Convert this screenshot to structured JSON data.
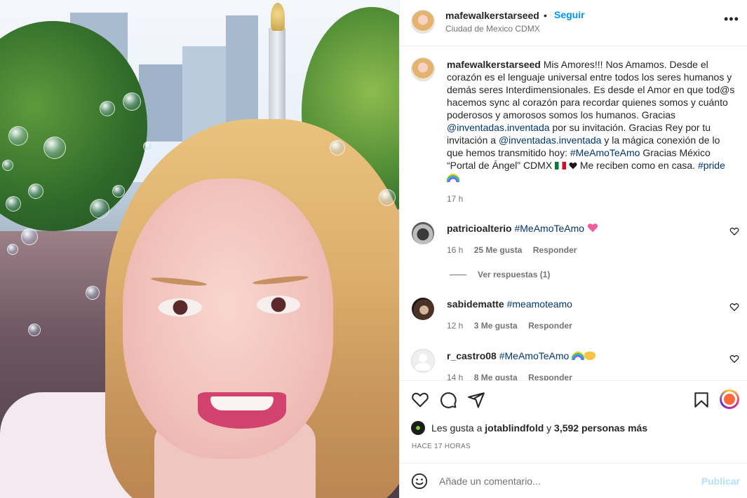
{
  "post": {
    "username": "mafewalkerstarseed",
    "separator": "•",
    "follow_label": "Seguir",
    "location": "Ciudad de Mexico CDMX",
    "more_label": "•••"
  },
  "caption": {
    "username": "mafewalkerstarseed",
    "text_1": "Mis Amores!!! Nos Amamos. Desde el corazón es el lenguaje universal entre todos los seres humanos y demás seres Interdimensionales. Es desde el Amor en que tod@s hacemos sync al corazón para recordar quienes somos y cuánto poderosos y amorosos somos los humanos. Gracias ",
    "mention_1": "@inventadas.inventada",
    "text_2": " por su invitación. Gracias Rey por tu invitación a ",
    "mention_2": "@inventadas.inventada",
    "text_3": " y la mágica conexión de lo que hemos transmitido hoy: ",
    "hashtag_1": "#MeAmoTeAmo",
    "text_4": " Gracias México “Portal de Ángel” CDMX ",
    "text_5": " Me reciben como en casa. ",
    "hashtag_2": "#pride",
    "time": "17 h"
  },
  "comments": [
    {
      "username": "patricioalterio",
      "hashtag": "#MeAmoTeAmo",
      "time": "16 h",
      "likes": "25 Me gusta",
      "reply_label": "Responder",
      "view_replies": "Ver respuestas (1)"
    },
    {
      "username": "sabidematte",
      "hashtag": "#meamoteamo",
      "time": "12 h",
      "likes": "3 Me gusta",
      "reply_label": "Responder"
    },
    {
      "username": "r_castro08",
      "hashtag": "#MeAmoTeAmo",
      "time": "14 h",
      "likes": "8 Me gusta",
      "reply_label": "Responder"
    }
  ],
  "likes_summary": {
    "prefix": "Les gusta a ",
    "user": "jotablindfold",
    "middle": " y ",
    "count": "3,592 personas más"
  },
  "posted_ago": "HACE 17 HORAS",
  "add_comment": {
    "placeholder": "Añade un comentario...",
    "publish_label": "Publicar"
  },
  "icons": {
    "like": "heart-icon",
    "comment": "comment-icon",
    "share": "share-icon",
    "save": "bookmark-icon",
    "emoji": "emoji-icon",
    "more": "more-options-icon"
  },
  "colors": {
    "accent": "#0095f6",
    "link": "#00376b",
    "secondary_text": "#737373",
    "publish_disabled": "#b2dffc"
  }
}
